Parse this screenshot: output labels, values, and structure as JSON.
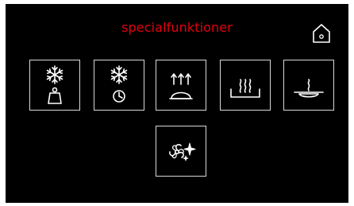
{
  "header": {
    "title": "specialfunktioner",
    "home_icon": "home-icon"
  },
  "colors": {
    "background": "#000000",
    "title": "#e3000f",
    "tile_border": "#d8d8d8",
    "icon": "#ffffff"
  },
  "functions": [
    {
      "id": "defrost-weight",
      "icons": [
        "snowflake-icon",
        "weight-icon"
      ]
    },
    {
      "id": "defrost-time",
      "icons": [
        "snowflake-icon",
        "clock-icon"
      ]
    },
    {
      "id": "plate-warming",
      "icons": [
        "heat-arrows-icon",
        "cloche-icon"
      ]
    },
    {
      "id": "keep-warm",
      "icons": [
        "steam-icon",
        "dish-icon"
      ]
    },
    {
      "id": "slow-cook",
      "icons": [
        "steam-icon",
        "plate-icon"
      ]
    },
    {
      "id": "cleaning",
      "icons": [
        "fan-sparkle-icon"
      ]
    }
  ]
}
